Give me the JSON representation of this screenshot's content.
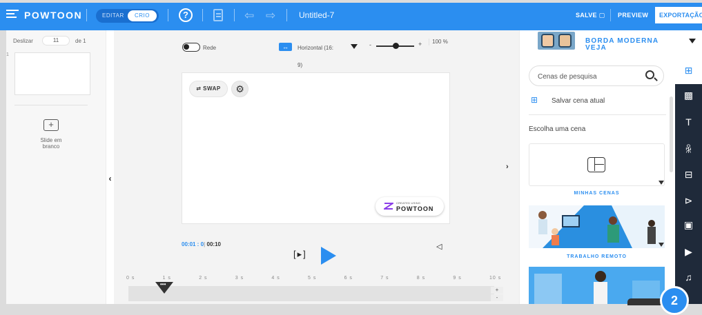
{
  "topbar": {
    "logo": "POWTOON",
    "mode_edit": "EDITAR",
    "mode_create": "CRIO",
    "help": "?",
    "doc_title": "Untitled-7",
    "save": "SALVE ▢",
    "preview": "PREVIEW",
    "export": "EXPORTAÇÃO",
    "accent_color": "#2b8ef0"
  },
  "slides_panel": {
    "label": "Deslizar",
    "current": "11",
    "of_label": "de 1",
    "thumb_index": "1",
    "blank_icon": "+",
    "blank_label": "Slide em branco"
  },
  "canvas": {
    "grid_label": "Rede",
    "orientation_label": "Horizontal (16:",
    "orientation_label_cont": "9)",
    "orientation_icon": "↔",
    "zoom_minus": "-",
    "zoom_plus": "+",
    "zoom_value": "100 %",
    "zoom_level": 0.5,
    "swap_label": "⇄ SWAP",
    "settings_icon": "⚙",
    "watermark_small": "CREATED USING",
    "watermark_brand": "POWTOON"
  },
  "player": {
    "current_time": "00:01 : 0",
    "separator": "|",
    "total_time": "00:10",
    "bracket_play": "[▸]",
    "volume_icon": "◁",
    "ticks": [
      "0 s",
      "1 s",
      "2 s",
      "3 s",
      "4 s",
      "5 s",
      "6 s",
      "7 s",
      "8 s",
      "9 s",
      "10 s"
    ],
    "playhead_dots": "•••",
    "zoom_in": "+",
    "zoom_out": "-"
  },
  "right_panel": {
    "theme_name_line1": "BORDA MODERNA",
    "theme_name_line2": "VEJA",
    "search_placeholder": "Cenas de pesquisa",
    "save_scene": "Salvar cena atual",
    "choose_scene": "Escolha uma cena",
    "my_scenes": "MINHAS CENAS",
    "remote_work": "TRABALHO REMOTO"
  },
  "toolrail": {
    "icons": [
      "scenes-icon",
      "background-icon",
      "text-icon",
      "characters-icon",
      "props-icon",
      "shapes-icon",
      "images-icon",
      "video-icon",
      "music-icon"
    ],
    "glyphs": [
      "⊞",
      "▩",
      "T",
      "ꆜ",
      "⊟",
      "⊳",
      "▣",
      "▶",
      "♫"
    ]
  },
  "help_bubble": "2"
}
